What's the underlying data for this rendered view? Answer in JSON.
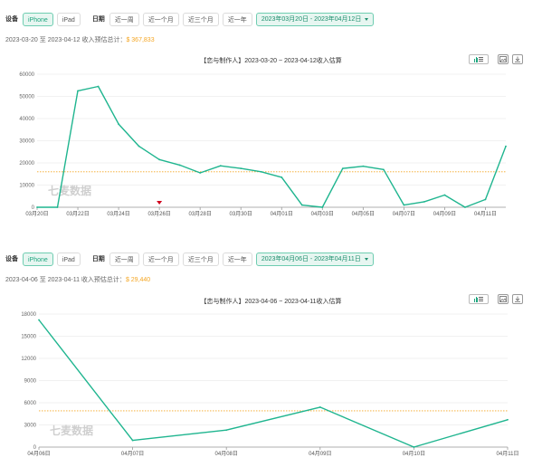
{
  "colors": {
    "accent": "#1fb58f",
    "average_line": "#f5a623",
    "marker": "#d0021b"
  },
  "icons": {
    "chart_toggle": "bar-list-toggle-icon",
    "save_image": "image-icon",
    "download": "download-icon",
    "caret": "caret-down-icon",
    "marker": "red-flag-icon"
  },
  "panel1": {
    "filters": {
      "device_label": "设备",
      "device_options": [
        "iPhone",
        "iPad"
      ],
      "device_selected": "iPhone",
      "date_label": "日期",
      "date_options": [
        "近一周",
        "近一个月",
        "近三个月",
        "近一年"
      ],
      "date_range": "2023年03月20日 - 2023年04月12日"
    },
    "summary_prefix": "2023-03-20 至 2023-04-12 收入预估总计：",
    "summary_amount": "$ 367,833",
    "chart_title": "【恋与制作人】2023-03-20 ~ 2023-04-12收入估算",
    "watermark": "七麦数据"
  },
  "panel2": {
    "filters": {
      "device_label": "设备",
      "device_options": [
        "iPhone",
        "iPad"
      ],
      "device_selected": "iPhone",
      "date_label": "日期",
      "date_options": [
        "近一周",
        "近一个月",
        "近三个月",
        "近一年"
      ],
      "date_range": "2023年04月06日 - 2023年04月11日"
    },
    "summary_prefix": "2023-04-06 至 2023-04-11 收入预估总计：",
    "summary_amount": "$ 29,440",
    "chart_title": "【恋与制作人】2023-04-06 ~ 2023-04-11收入估算",
    "watermark": "七麦数据"
  },
  "chart_data": [
    {
      "type": "line",
      "title": "【恋与制作人】2023-03-20 ~ 2023-04-12收入估算",
      "x": [
        "03月20日",
        "03月21日",
        "03月22日",
        "03月23日",
        "03月24日",
        "03月25日",
        "03月26日",
        "03月27日",
        "03月28日",
        "03月29日",
        "03月30日",
        "03月31日",
        "04月01日",
        "04月02日",
        "04月03日",
        "04月04日",
        "04月05日",
        "04月06日",
        "04月07日",
        "04月08日",
        "04月09日",
        "04月10日",
        "04月11日",
        "04月12日"
      ],
      "x_tick_labels": [
        "03月20日",
        "03月22日",
        "03月24日",
        "03月26日",
        "03月28日",
        "03月30日",
        "04月01日",
        "04月03日",
        "04月05日",
        "04月07日",
        "04月09日",
        "04月11日"
      ],
      "series": [
        {
          "values": [
            0,
            0,
            52500,
            54500,
            37500,
            27500,
            21500,
            19000,
            15500,
            18700,
            17500,
            16000,
            13500,
            1000,
            0,
            17500,
            18500,
            17000,
            1000,
            2500,
            5500,
            0,
            3500,
            27500
          ]
        }
      ],
      "average": 16000,
      "ylim": [
        0,
        60000
      ],
      "yticks": [
        0,
        10000,
        20000,
        30000,
        40000,
        50000,
        60000
      ],
      "grid": true,
      "marker_at": "03月26日"
    },
    {
      "type": "line",
      "title": "【恋与制作人】2023-04-06 ~ 2023-04-11收入估算",
      "x": [
        "04月06日",
        "04月07日",
        "04月08日",
        "04月09日",
        "04月10日",
        "04月11日"
      ],
      "x_tick_labels": [
        "04月06日",
        "04月07日",
        "04月08日",
        "04月09日",
        "04月10日",
        "04月11日"
      ],
      "series": [
        {
          "values": [
            17200,
            900,
            2300,
            5400,
            0,
            3700
          ]
        }
      ],
      "average": 4900,
      "ylim": [
        0,
        18000
      ],
      "yticks": [
        0,
        3000,
        6000,
        9000,
        12000,
        15000,
        18000
      ],
      "grid": true
    }
  ]
}
